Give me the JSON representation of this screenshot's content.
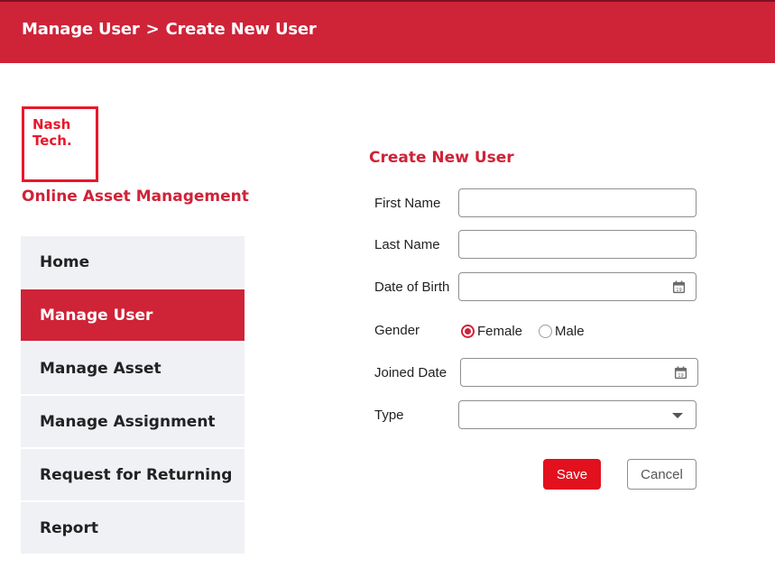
{
  "header": {
    "breadcrumb": [
      "Manage User",
      ">",
      "Create New User"
    ],
    "color": "#cf2338"
  },
  "brand": {
    "logo_line1": "Nash",
    "logo_line2": "Tech.",
    "app_title": "Online Asset Management"
  },
  "sidebar": {
    "items": [
      {
        "label": "Home",
        "active": false
      },
      {
        "label": "Manage User",
        "active": true
      },
      {
        "label": "Manage Asset",
        "active": false
      },
      {
        "label": "Manage Assignment",
        "active": false
      },
      {
        "label": "Request for Returning",
        "active": false
      },
      {
        "label": "Report",
        "active": false
      }
    ]
  },
  "form": {
    "title": "Create New User",
    "first_name": {
      "label": "First Name",
      "value": ""
    },
    "last_name": {
      "label": "Last Name",
      "value": ""
    },
    "date_of_birth": {
      "label": "Date of Birth",
      "value": "",
      "icon": "calendar-icon"
    },
    "gender": {
      "label": "Gender",
      "options": [
        {
          "label": "Female",
          "selected": true
        },
        {
          "label": "Male",
          "selected": false
        }
      ]
    },
    "joined_date": {
      "label": "Joined Date",
      "value": "",
      "icon": "calendar-icon"
    },
    "type": {
      "label": "Type",
      "value": ""
    },
    "save_label": "Save",
    "cancel_label": "Cancel"
  }
}
